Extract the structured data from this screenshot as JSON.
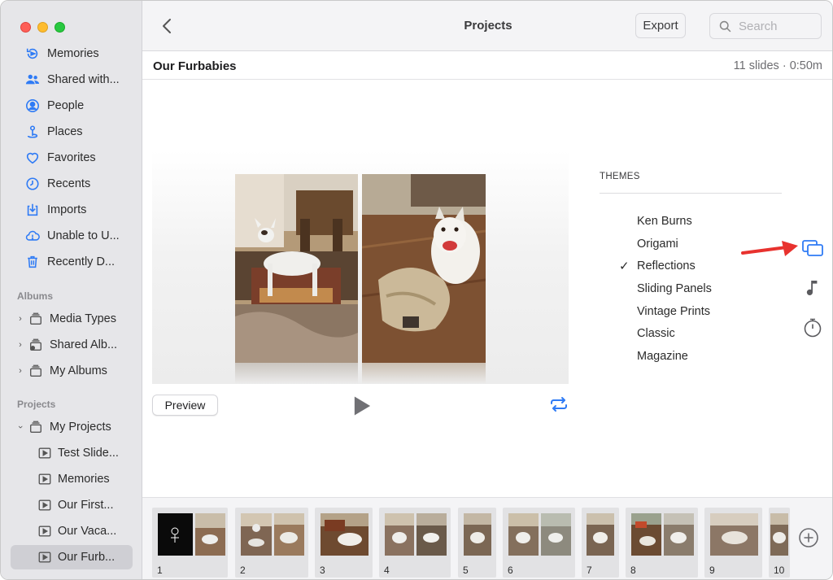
{
  "sidebar": {
    "items": [
      {
        "label": "Memories",
        "icon": "memories-icon"
      },
      {
        "label": "Shared with...",
        "icon": "shared-with-you-icon"
      },
      {
        "label": "People",
        "icon": "people-icon"
      },
      {
        "label": "Places",
        "icon": "places-icon"
      },
      {
        "label": "Favorites",
        "icon": "heart-icon"
      },
      {
        "label": "Recents",
        "icon": "clock-icon"
      },
      {
        "label": "Imports",
        "icon": "import-icon"
      },
      {
        "label": "Unable to U...",
        "icon": "cloud-warning-icon"
      },
      {
        "label": "Recently D...",
        "icon": "trash-icon"
      }
    ],
    "albums_header": "Albums",
    "albums": [
      {
        "label": "Media Types"
      },
      {
        "label": "Shared Alb..."
      },
      {
        "label": "My Albums"
      }
    ],
    "projects_header": "Projects",
    "my_projects": "My Projects",
    "projects": [
      {
        "label": "Test Slide..."
      },
      {
        "label": "Memories"
      },
      {
        "label": "Our First..."
      },
      {
        "label": "Our Vaca..."
      },
      {
        "label": "Our Furb...",
        "selected": true
      }
    ]
  },
  "toolbar": {
    "title": "Projects",
    "export_label": "Export",
    "search_placeholder": "Search"
  },
  "project": {
    "name": "Our Furbabies",
    "meta": "11 slides · 0:50m"
  },
  "player": {
    "preview_label": "Preview"
  },
  "themes": {
    "header": "THEMES",
    "selected": "Reflections",
    "items": [
      "Ken Burns",
      "Origami",
      "Reflections",
      "Sliding Panels",
      "Vintage Prints",
      "Classic",
      "Magazine"
    ]
  },
  "side_icons": [
    "themes-icon",
    "music-note-icon",
    "duration-timer-icon"
  ],
  "colors": {
    "accent": "#2f7bf5",
    "annotation_arrow": "#e8322e",
    "selected_sidebar": "#cfcfd4"
  },
  "filmstrip": {
    "slides": [
      "1",
      "2",
      "3",
      "4",
      "5",
      "6",
      "7",
      "8",
      "9",
      "10"
    ]
  }
}
